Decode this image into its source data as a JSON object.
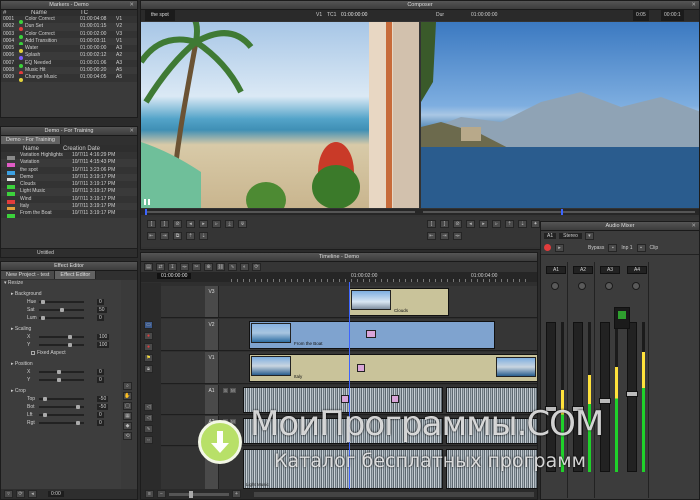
{
  "markers": {
    "title": "Markers - Demo",
    "columns": [
      "#",
      "",
      "Name",
      "TC"
    ],
    "rows": [
      {
        "num": "0001",
        "color": "#3cd23c",
        "name": "Color Correct",
        "tc": "01:00:04:08",
        "trk": "V1"
      },
      {
        "num": "0002",
        "color": "#e23c3c",
        "name": "Dun Set",
        "tc": "01:00:01:15",
        "trk": "V2"
      },
      {
        "num": "0003",
        "color": "#3cd23c",
        "name": "Color Correct",
        "tc": "01:00:02:00",
        "trk": "V3"
      },
      {
        "num": "0004",
        "color": "#3cd23c",
        "name": "Add Transition",
        "tc": "01:00:03:11",
        "trk": "V1"
      },
      {
        "num": "0005",
        "color": "#e2d23c",
        "name": "Water",
        "tc": "01:00:00:00",
        "trk": "A3"
      },
      {
        "num": "0006",
        "color": "#7a5cff",
        "name": "Splash",
        "tc": "01:00:02:12",
        "trk": "A2"
      },
      {
        "num": "0007",
        "color": "#3cd23c",
        "name": "EQ Needed",
        "tc": "01:00:01:06",
        "trk": "A3"
      },
      {
        "num": "0008",
        "color": "#e23c3c",
        "name": "Music Hit",
        "tc": "01:00:00:20",
        "trk": "A5"
      },
      {
        "num": "0009",
        "color": "#e2d23c",
        "name": "Change Music",
        "tc": "01:00:04:05",
        "trk": "A5"
      }
    ]
  },
  "bin": {
    "title": "Demo - For Training",
    "tab": "Demo - For Training",
    "columns": [
      "Name",
      "Creation Date"
    ],
    "rows": [
      {
        "name": "Variation Highlights",
        "date": "10/7/11 4:16:29 PM",
        "color": "#8a8a8a"
      },
      {
        "name": "Variation",
        "date": "10/7/11 4:15:43 PM",
        "color": "#e25cc6"
      },
      {
        "name": "the spot",
        "date": "10/7/11 3:23:06 PM",
        "color": "#3ca0e2"
      },
      {
        "name": "Demo",
        "date": "10/7/11 3:19:17 PM",
        "color": "#e2e2e2"
      },
      {
        "name": "Clouds",
        "date": "10/7/11 3:19:17 PM",
        "color": "#3cd23c"
      },
      {
        "name": "Light Music",
        "date": "10/7/11 3:19:17 PM",
        "color": "#3cd23c"
      },
      {
        "name": "Wind",
        "date": "10/7/11 3:19:17 PM",
        "color": "#e23c3c"
      },
      {
        "name": "Italy",
        "date": "10/7/11 3:19:17 PM",
        "color": "#e2a03c"
      },
      {
        "name": "From the Boat",
        "date": "10/7/11 3:19:17 PM",
        "color": "#3cd23c"
      }
    ],
    "footer": "Untitled"
  },
  "effect_editor": {
    "title": "Effect Editor",
    "project_tab": "New Project - test",
    "effect_tab": "Effect Editor",
    "effect_name": "Resize",
    "groups": [
      {
        "name": "Background",
        "params": [
          {
            "label": "Hue",
            "value": "0",
            "pos": 0.05
          },
          {
            "label": "Sat",
            "value": "50",
            "pos": 0.5
          },
          {
            "label": "Lum",
            "value": "0",
            "pos": 0.05
          }
        ]
      },
      {
        "name": "Scaling",
        "params": [
          {
            "label": "X",
            "value": "100",
            "pos": 0.7
          },
          {
            "label": "Y",
            "value": "100",
            "pos": 0.7
          }
        ]
      },
      {
        "name": "Position",
        "params": [
          {
            "label": "X",
            "value": "0",
            "pos": 0.45
          },
          {
            "label": "Y",
            "value": "0",
            "pos": 0.45
          }
        ]
      },
      {
        "name": "Crop",
        "params": [
          {
            "label": "Top",
            "value": "-50",
            "pos": 0.1
          },
          {
            "label": "Bot",
            "value": "-50",
            "pos": 0.9
          },
          {
            "label": "Lft",
            "value": "0",
            "pos": 0.1
          },
          {
            "label": "Rgt",
            "value": "0",
            "pos": 0.9
          }
        ]
      }
    ],
    "fixed_aspect": "Fixed Aspect",
    "timecode": "0:00"
  },
  "composer": {
    "title": "Composer",
    "source_name": "the spot",
    "source_track": "V1",
    "source_tc_label": "TC1",
    "source_tc": "01:00:00:00",
    "record_label": "Dur",
    "record_tc": "01:00:00:00",
    "right_tc1": "0:05",
    "right_tc2": "00:00:1"
  },
  "timeline": {
    "title": "Timeline - Demo",
    "ruler_tc": "01:00:00:00",
    "ruler_marks": [
      "01:00:02:00",
      "01:00:04:00"
    ],
    "tracks": [
      {
        "name": "V3",
        "clips": [
          {
            "label": "Clouds"
          }
        ]
      },
      {
        "name": "V2",
        "clips": [
          {
            "label": "From the Boat"
          }
        ]
      },
      {
        "name": "V1",
        "clips": [
          {
            "label": "Italy"
          }
        ]
      },
      {
        "name": "A1",
        "clips": []
      },
      {
        "name": "A2",
        "clips": []
      },
      {
        "name": "A3",
        "clips": [
          {
            "label": "Light Music"
          }
        ]
      }
    ],
    "patch_label": "V1",
    "track_flag_s": "S",
    "track_flag_m": "M"
  },
  "audio_mixer": {
    "title": "Audio Mixer",
    "bank_label": "A1",
    "mode": "Stereo",
    "bypass_label": "Bypass",
    "input_label": "Inp 1",
    "clip_label": "Clip",
    "channels": [
      {
        "name": "A1",
        "level": 0.55,
        "fader": 0.45
      },
      {
        "name": "A2",
        "level": 0.65,
        "fader": 0.45
      },
      {
        "name": "A3",
        "level": 0.7,
        "fader": 0.5
      },
      {
        "name": "A4",
        "level": 0.8,
        "fader": 0.55
      }
    ]
  },
  "watermark": {
    "title": "МоиПрограммы.COM",
    "subtitle": "Каталог бесплатных программ"
  }
}
